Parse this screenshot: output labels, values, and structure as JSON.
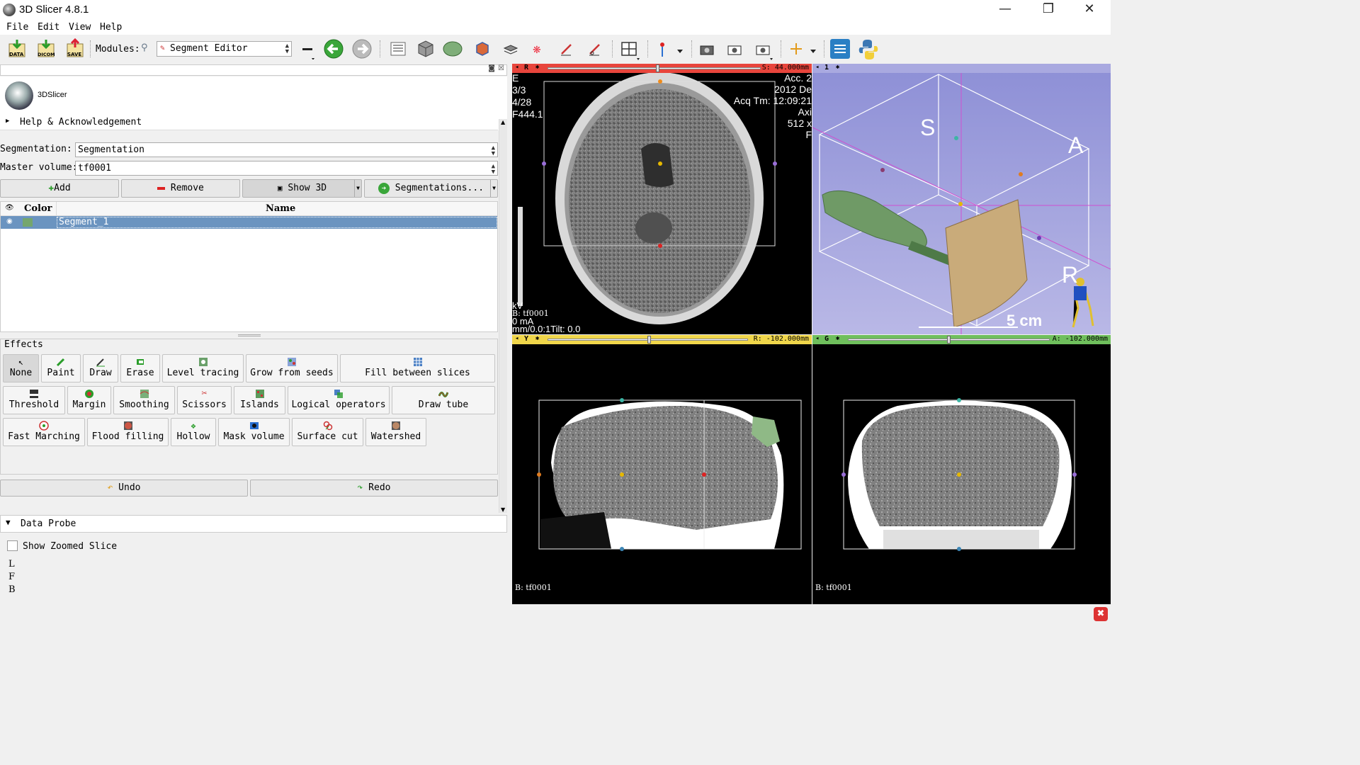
{
  "window": {
    "title": "3D Slicer 4.8.1",
    "minimize": "—",
    "maximize": "❐",
    "close": "✕"
  },
  "menu": [
    "File",
    "Edit",
    "View",
    "Help"
  ],
  "toolbar": {
    "data_label": "DATA",
    "dicom_label": "DICOM",
    "save_label": "SAVE",
    "modules_label": "Modules:",
    "module_selected": "Segment Editor"
  },
  "panel": {
    "logo_text": "3DSlicer",
    "help_section": "Help & Acknowledgement",
    "segmentation_label": "Segmentation:",
    "segmentation_value": "Segmentation",
    "master_volume_label": "Master volume:",
    "master_volume_value": "tf0001",
    "buttons": {
      "add": "Add",
      "remove": "Remove",
      "show3d": "Show 3D",
      "segmentations": "Segmentations..."
    },
    "table": {
      "col_color": "Color",
      "col_name": "Name",
      "rows": [
        {
          "name": "Segment_1",
          "color": "#75a66e"
        }
      ]
    },
    "effects_title": "Effects",
    "effects_row1": [
      "None",
      "Paint",
      "Draw",
      "Erase",
      "Level tracing",
      "Grow from seeds",
      "Fill between slices"
    ],
    "effects_row2": [
      "Threshold",
      "Margin",
      "Smoothing",
      "Scissors",
      "Islands",
      "Logical operators",
      "Draw tube"
    ],
    "effects_row3": [
      "Fast Marching",
      "Flood filling",
      "Hollow",
      "Mask volume",
      "Surface cut",
      "Watershed"
    ],
    "undo": "Undo",
    "redo": "Redo",
    "data_probe_title": "Data Probe",
    "show_zoomed_slice": "Show Zoomed Slice",
    "probe_lines": [
      "L",
      "F",
      "B"
    ]
  },
  "views": {
    "red": {
      "letter": "R",
      "offset": "S: 44.000mm",
      "slider": 0.52,
      "corner_left": [
        "E",
        "3/3",
        "4/28",
        "F444.1"
      ],
      "corner_right": [
        "Acc. 2",
        "2012 De",
        "Acq Tm: 12:09:21",
        "",
        "Axi",
        "512 x",
        "F"
      ],
      "bottom_left": [
        "kV",
        "B: tf0001",
        "0 mA",
        "mm/0.0:1Tilt: 0.0"
      ]
    },
    "three_d": {
      "label": "1",
      "S": "S",
      "A": "A",
      "R": "R",
      "scale": "5 cm"
    },
    "yellow": {
      "letter": "Y",
      "offset": "R: -102.000mm",
      "slider": 0.51,
      "label": "B: tf0001"
    },
    "green": {
      "letter": "G",
      "offset": "A: -102.000mm",
      "slider": 0.5,
      "label": "B: tf0001"
    }
  },
  "colors": {
    "red_bar": "#e8453c",
    "yellow_bar": "#f0d64a",
    "green_bar": "#6fbf5c",
    "selection": "#6b94c0"
  }
}
